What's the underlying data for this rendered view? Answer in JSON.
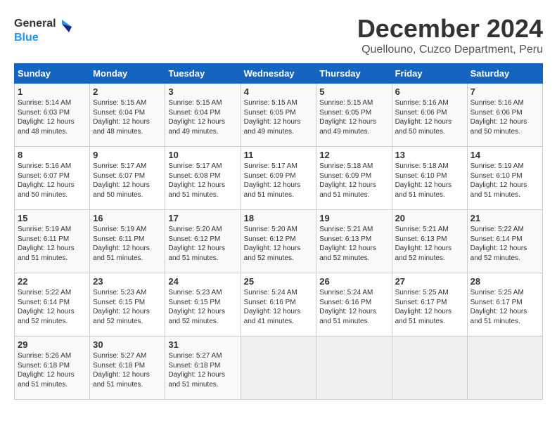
{
  "header": {
    "logo_line1": "General",
    "logo_line2": "Blue",
    "title": "December 2024",
    "subtitle": "Quellouno, Cuzco Department, Peru"
  },
  "calendar": {
    "days_of_week": [
      "Sunday",
      "Monday",
      "Tuesday",
      "Wednesday",
      "Thursday",
      "Friday",
      "Saturday"
    ],
    "weeks": [
      [
        {
          "num": "",
          "info": ""
        },
        {
          "num": "2",
          "info": "Sunrise: 5:15 AM\nSunset: 6:04 PM\nDaylight: 12 hours\nand 48 minutes."
        },
        {
          "num": "3",
          "info": "Sunrise: 5:15 AM\nSunset: 6:04 PM\nDaylight: 12 hours\nand 49 minutes."
        },
        {
          "num": "4",
          "info": "Sunrise: 5:15 AM\nSunset: 6:05 PM\nDaylight: 12 hours\nand 49 minutes."
        },
        {
          "num": "5",
          "info": "Sunrise: 5:15 AM\nSunset: 6:05 PM\nDaylight: 12 hours\nand 49 minutes."
        },
        {
          "num": "6",
          "info": "Sunrise: 5:16 AM\nSunset: 6:06 PM\nDaylight: 12 hours\nand 50 minutes."
        },
        {
          "num": "7",
          "info": "Sunrise: 5:16 AM\nSunset: 6:06 PM\nDaylight: 12 hours\nand 50 minutes."
        }
      ],
      [
        {
          "num": "8",
          "info": "Sunrise: 5:16 AM\nSunset: 6:07 PM\nDaylight: 12 hours\nand 50 minutes."
        },
        {
          "num": "9",
          "info": "Sunrise: 5:17 AM\nSunset: 6:07 PM\nDaylight: 12 hours\nand 50 minutes."
        },
        {
          "num": "10",
          "info": "Sunrise: 5:17 AM\nSunset: 6:08 PM\nDaylight: 12 hours\nand 51 minutes."
        },
        {
          "num": "11",
          "info": "Sunrise: 5:17 AM\nSunset: 6:09 PM\nDaylight: 12 hours\nand 51 minutes."
        },
        {
          "num": "12",
          "info": "Sunrise: 5:18 AM\nSunset: 6:09 PM\nDaylight: 12 hours\nand 51 minutes."
        },
        {
          "num": "13",
          "info": "Sunrise: 5:18 AM\nSunset: 6:10 PM\nDaylight: 12 hours\nand 51 minutes."
        },
        {
          "num": "14",
          "info": "Sunrise: 5:19 AM\nSunset: 6:10 PM\nDaylight: 12 hours\nand 51 minutes."
        }
      ],
      [
        {
          "num": "15",
          "info": "Sunrise: 5:19 AM\nSunset: 6:11 PM\nDaylight: 12 hours\nand 51 minutes."
        },
        {
          "num": "16",
          "info": "Sunrise: 5:19 AM\nSunset: 6:11 PM\nDaylight: 12 hours\nand 51 minutes."
        },
        {
          "num": "17",
          "info": "Sunrise: 5:20 AM\nSunset: 6:12 PM\nDaylight: 12 hours\nand 51 minutes."
        },
        {
          "num": "18",
          "info": "Sunrise: 5:20 AM\nSunset: 6:12 PM\nDaylight: 12 hours\nand 52 minutes."
        },
        {
          "num": "19",
          "info": "Sunrise: 5:21 AM\nSunset: 6:13 PM\nDaylight: 12 hours\nand 52 minutes."
        },
        {
          "num": "20",
          "info": "Sunrise: 5:21 AM\nSunset: 6:13 PM\nDaylight: 12 hours\nand 52 minutes."
        },
        {
          "num": "21",
          "info": "Sunrise: 5:22 AM\nSunset: 6:14 PM\nDaylight: 12 hours\nand 52 minutes."
        }
      ],
      [
        {
          "num": "22",
          "info": "Sunrise: 5:22 AM\nSunset: 6:14 PM\nDaylight: 12 hours\nand 52 minutes."
        },
        {
          "num": "23",
          "info": "Sunrise: 5:23 AM\nSunset: 6:15 PM\nDaylight: 12 hours\nand 52 minutes."
        },
        {
          "num": "24",
          "info": "Sunrise: 5:23 AM\nSunset: 6:15 PM\nDaylight: 12 hours\nand 52 minutes."
        },
        {
          "num": "25",
          "info": "Sunrise: 5:24 AM\nSunset: 6:16 PM\nDaylight: 12 hours\nand 41 minutes."
        },
        {
          "num": "26",
          "info": "Sunrise: 5:24 AM\nSunset: 6:16 PM\nDaylight: 12 hours\nand 51 minutes."
        },
        {
          "num": "27",
          "info": "Sunrise: 5:25 AM\nSunset: 6:17 PM\nDaylight: 12 hours\nand 51 minutes."
        },
        {
          "num": "28",
          "info": "Sunrise: 5:25 AM\nSunset: 6:17 PM\nDaylight: 12 hours\nand 51 minutes."
        }
      ],
      [
        {
          "num": "29",
          "info": "Sunrise: 5:26 AM\nSunset: 6:18 PM\nDaylight: 12 hours\nand 51 minutes."
        },
        {
          "num": "30",
          "info": "Sunrise: 5:27 AM\nSunset: 6:18 PM\nDaylight: 12 hours\nand 51 minutes."
        },
        {
          "num": "31",
          "info": "Sunrise: 5:27 AM\nSunset: 6:18 PM\nDaylight: 12 hours\nand 51 minutes."
        },
        {
          "num": "",
          "info": ""
        },
        {
          "num": "",
          "info": ""
        },
        {
          "num": "",
          "info": ""
        },
        {
          "num": "",
          "info": ""
        }
      ]
    ],
    "first_week_first_cell": {
      "num": "1",
      "info": "Sunrise: 5:14 AM\nSunset: 6:03 PM\nDaylight: 12 hours\nand 48 minutes."
    }
  }
}
